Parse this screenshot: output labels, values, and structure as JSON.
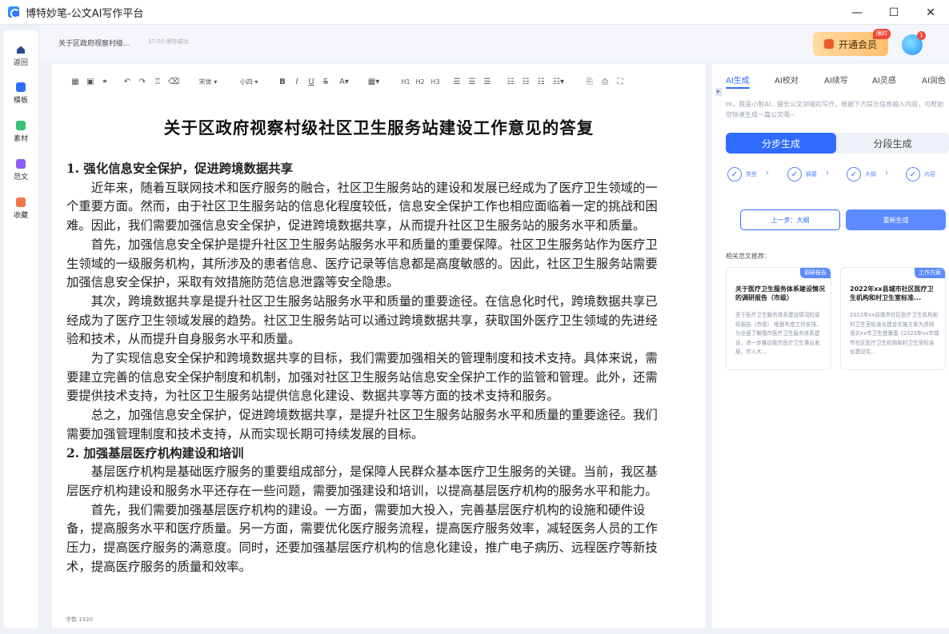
{
  "window": {
    "title": "博特妙笔-公文AI写作平台",
    "minimize": "—",
    "maximize": "☐",
    "close": "✕"
  },
  "nav": {
    "items": [
      {
        "label": "返回",
        "icon": "home-icon",
        "color": "#2b4a8c"
      },
      {
        "label": "模板",
        "icon": "template-icon",
        "color": "#2f6bff"
      },
      {
        "label": "素材",
        "icon": "material-icon",
        "color": "#38c172"
      },
      {
        "label": "范文",
        "icon": "sample-icon",
        "color": "#8b5cf6"
      },
      {
        "label": "收藏",
        "icon": "favorite-icon",
        "color": "#f2764a"
      }
    ]
  },
  "topbar": {
    "doc_name": "关于区政府视察村级...",
    "save_status": "17:00 保存成功",
    "vip_label": "开通会员",
    "vip_badge": "限时",
    "avatar_badge": "1"
  },
  "toolbar": {
    "font_family": "宋体",
    "font_size": "小四",
    "bold": "B",
    "italic": "I",
    "underline": "U",
    "strike": "S",
    "h1": "H1",
    "h2": "H2",
    "h3": "H3"
  },
  "document": {
    "title": "关于区政府视察村级社区卫生服务站建设工作意见的答复",
    "paragraphs": [
      {
        "type": "heading",
        "text": "1.  强化信息安全保护，促进跨境数据共享"
      },
      {
        "type": "para",
        "text": "近年来，随着互联网技术和医疗服务的融合，社区卫生服务站的建设和发展已经成为了医疗卫生领域的一个重要方面。然而，由于社区卫生服务站的信息化程度较低，信息安全保护工作也相应面临着一定的挑战和困难。因此，我们需要加强信息安全保护，促进跨境数据共享，从而提升社区卫生服务站的服务水平和质量。"
      },
      {
        "type": "para",
        "text": "首先，加强信息安全保护是提升社区卫生服务站服务水平和质量的重要保障。社区卫生服务站作为医疗卫生领域的一级服务机构，其所涉及的患者信息、医疗记录等信息都是高度敏感的。因此，社区卫生服务站需要加强信息安全保护，采取有效措施防范信息泄露等安全隐患。"
      },
      {
        "type": "para",
        "text": "其次，跨境数据共享是提升社区卫生服务站服务水平和质量的重要途径。在信息化时代，跨境数据共享已经成为了医疗卫生领域发展的趋势。社区卫生服务站可以通过跨境数据共享，获取国外医疗卫生领域的先进经验和技术，从而提升自身服务水平和质量。"
      },
      {
        "type": "para",
        "text": "为了实现信息安全保护和跨境数据共享的目标，我们需要加强相关的管理制度和技术支持。具体来说，需要建立完善的信息安全保护制度和机制，加强对社区卫生服务站信息安全保护工作的监管和管理。此外，还需要提供技术支持，为社区卫生服务站提供信息化建设、数据共享等方面的技术支持和服务。"
      },
      {
        "type": "para",
        "text": "总之，加强信息安全保护，促进跨境数据共享，是提升社区卫生服务站服务水平和质量的重要途径。我们需要加强管理制度和技术支持，从而实现长期可持续发展的目标。"
      },
      {
        "type": "heading",
        "text": "2.  加强基层医疗机构建设和培训"
      },
      {
        "type": "para",
        "text": "基层医疗机构是基础医疗服务的重要组成部分，是保障人民群众基本医疗卫生服务的关键。当前，我区基层医疗机构建设和服务水平还存在一些问题，需要加强建设和培训，以提高基层医疗机构的服务水平和能力。"
      },
      {
        "type": "para",
        "text": "首先，我们需要加强基层医疗机构的建设。一方面，需要加大投入，完善基层医疗机构的设施和硬件设备，提高服务水平和医疗质量。另一方面，需要优化医疗服务流程，提高医疗服务效率，减轻医务人员的工作压力，提高医疗服务的满意度。同时，还要加强基层医疗机构的信息化建设，推广电子病历、远程医疗等新技术，提高医疗服务的质量和效率。"
      }
    ],
    "word_count": "字数 1920"
  },
  "panel": {
    "tabs": [
      "AI生成",
      "AI校对",
      "AI续写",
      "AI灵感",
      "AI润色"
    ],
    "greeting": "Hi，我是小智AI，擅长公文领域的写作，根据下方提示信息输入内容，可帮助您快速生成一篇公文哦~",
    "mode_step": "分步生成",
    "mode_section": "分段生成",
    "steps": [
      "类型",
      "摘要",
      "大纲",
      "内容"
    ],
    "prev_button": "上一步：大纲",
    "regenerate_button": "重新生成",
    "recommend_title": "相关范文推荐：",
    "cards": [
      {
        "tag": "调研报告",
        "title": "关于医疗卫生服务体系建设情况的调研报告（市级）",
        "desc": "关于医疗卫生服务体系建设情况的调研报告（市级） 根据年度工作安排，为全面了解我市医疗卫生服务体系建设，进一步推动我市医疗卫生事业发展，市人大..."
      },
      {
        "tag": "工作方案",
        "title": "2022年xx县城市社区医疗卫生机构和村卫生室标准...",
        "desc": "2022年xx县城市社区医疗卫生机构和村卫生室标准化建设实施方案为贯彻落实xx市卫生健康委《2022年xx市城市社区医疗卫生机构和村卫生室标准化建设实..."
      }
    ]
  }
}
